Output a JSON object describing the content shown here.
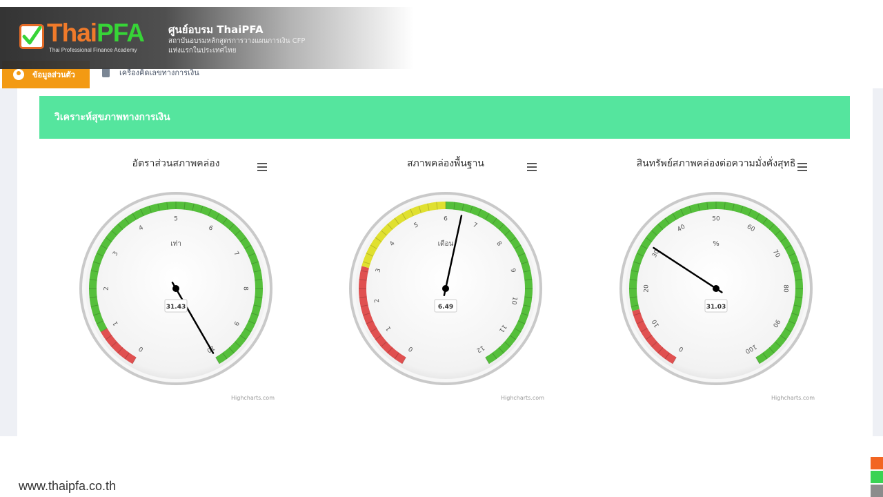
{
  "brand": {
    "logo_thai": "Thai",
    "logo_pfa": "PFA",
    "logo_subtitle": "Thai Professional Finance Academy",
    "name": "ศูนย์อบรม ThaiPFA",
    "line1": "สถาบันอบรมหลักสูตรการวางแผนการเงิน CFP",
    "line2": "แห่งแรกในประเทศไทย"
  },
  "nav": {
    "tab_personal": "ข้อมูลส่วนตัว",
    "tab_calculator": "เครื่องคิดเลขทางการเงิน"
  },
  "section": {
    "title": "วิเคราะห์สุขภาพทางการเงิน"
  },
  "credit": "Highcharts.com",
  "footer": {
    "url": "www.thaipfa.co.th"
  },
  "colors": {
    "accent_orange": "#f39a13",
    "section_green": "#55e59e",
    "band_red": "#e05050",
    "band_yellow": "#e0e030",
    "band_green": "#55bf3b"
  },
  "chart_data": [
    {
      "type": "gauge",
      "title": "อัตราส่วนสภาพคล่อง",
      "unit": "เท่า",
      "min": 0,
      "max": 10,
      "value": 31.43,
      "value_label": "31.43",
      "ticks": [
        "0",
        "1",
        "2",
        "3",
        "4",
        "5",
        "6",
        "7",
        "8",
        "9",
        "10"
      ],
      "bands": [
        {
          "from": 0,
          "to": 1,
          "color": "#e05050"
        },
        {
          "from": 1,
          "to": 10,
          "color": "#55bf3b"
        }
      ]
    },
    {
      "type": "gauge",
      "title": "สภาพคล่องพื้นฐาน",
      "unit": "เดือน",
      "min": 0,
      "max": 12,
      "value": 6.49,
      "value_label": "6.49",
      "ticks": [
        "0",
        "1",
        "2",
        "3",
        "4",
        "5",
        "6",
        "7",
        "8",
        "9",
        "10",
        "11",
        "12"
      ],
      "bands": [
        {
          "from": 0,
          "to": 3,
          "color": "#e05050"
        },
        {
          "from": 3,
          "to": 6,
          "color": "#e0e030"
        },
        {
          "from": 6,
          "to": 12,
          "color": "#55bf3b"
        }
      ]
    },
    {
      "type": "gauge",
      "title": "สินทรัพย์สภาพคล่องต่อความมั่งคั่งสุทธิ",
      "unit": "%",
      "min": 0,
      "max": 100,
      "value": 31.03,
      "value_label": "31.03",
      "ticks": [
        "0",
        "10",
        "20",
        "30",
        "40",
        "50",
        "60",
        "70",
        "80",
        "90",
        "100"
      ],
      "bands": [
        {
          "from": 0,
          "to": 15,
          "color": "#e05050"
        },
        {
          "from": 15,
          "to": 100,
          "color": "#55bf3b"
        }
      ]
    }
  ]
}
